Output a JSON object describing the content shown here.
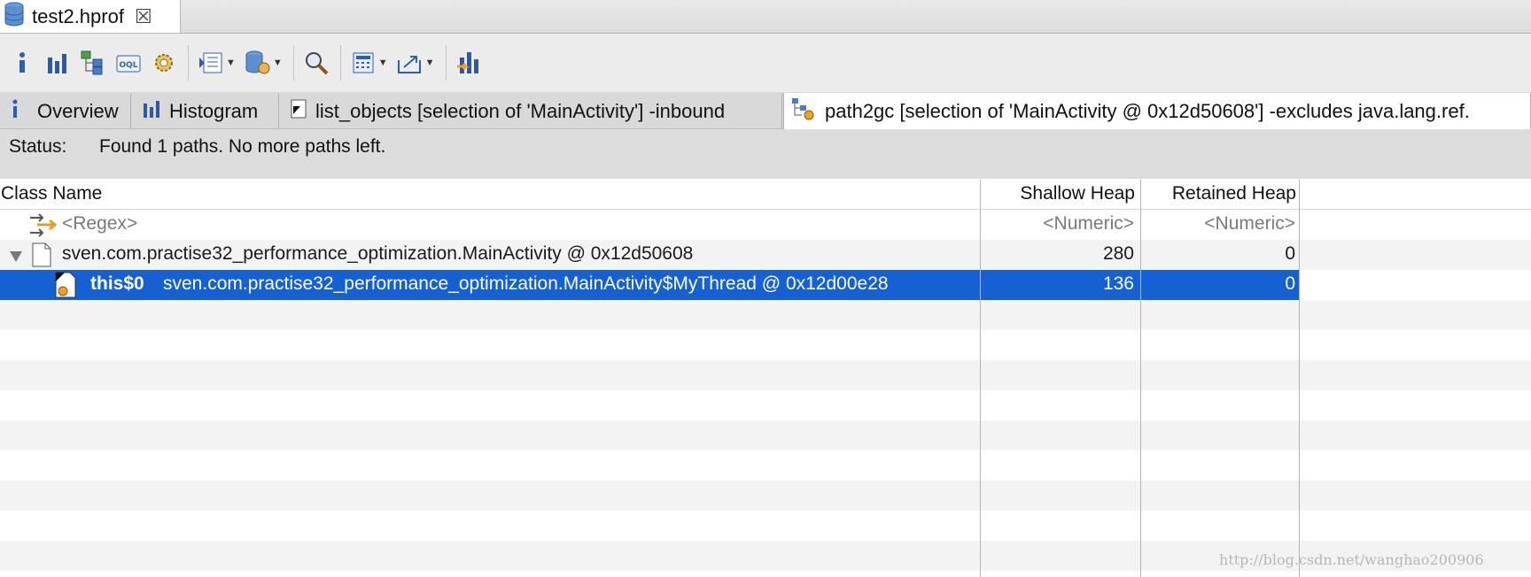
{
  "editor": {
    "tab_title": "test2.hprof",
    "close_glyph": "☒"
  },
  "toolbar": {
    "buttons": [
      {
        "icon": "info-icon"
      },
      {
        "icon": "histogram-icon"
      },
      {
        "icon": "dominator-tree-icon"
      },
      {
        "icon": "oql-icon"
      },
      {
        "icon": "heap-dump-overview-icon"
      },
      {
        "icon": "query-browser-icon",
        "dropdown": true
      },
      {
        "icon": "reports-icon",
        "dropdown": true
      },
      {
        "icon": "search-icon"
      },
      {
        "icon": "calculator-icon",
        "dropdown": true
      },
      {
        "icon": "export-icon",
        "dropdown": true
      },
      {
        "icon": "compare-icon"
      }
    ],
    "oql_text": "OQL"
  },
  "result_tabs": [
    {
      "label": "Overview",
      "icon": "info-icon"
    },
    {
      "label": "Histogram",
      "icon": "histogram-icon"
    },
    {
      "label": "list_objects [selection of 'MainActivity'] -inbound",
      "icon": "list-objects-icon"
    },
    {
      "label": "path2gc [selection of 'MainActivity @ 0x12d50608'] -excludes java.lang.ref.",
      "icon": "path2gc-icon",
      "active": true
    }
  ],
  "status": {
    "label": "Status:",
    "text": "Found 1 paths. No more paths left."
  },
  "table": {
    "columns": [
      "Class Name",
      "Shallow Heap",
      "Retained Heap"
    ],
    "filter_row": {
      "name": "<Regex>",
      "shallow": "<Numeric>",
      "retained": "<Numeric>"
    },
    "rows": [
      {
        "prefix": "",
        "name": "sven.com.practise32_performance_optimization.MainActivity @ 0x12d50608",
        "shallow": "280",
        "retained": "0",
        "expanded": true
      },
      {
        "prefix": "this$0",
        "name": "sven.com.practise32_performance_optimization.MainActivity$MyThread @ 0x12d00e28",
        "shallow": "136",
        "retained": "0",
        "selected": true
      }
    ]
  },
  "watermark": "http://blog.csdn.net/wanghao200906",
  "colors": {
    "selection": "#1561d4",
    "alt_row": "#f3f3f3",
    "status_bg": "#dcdcdc"
  }
}
